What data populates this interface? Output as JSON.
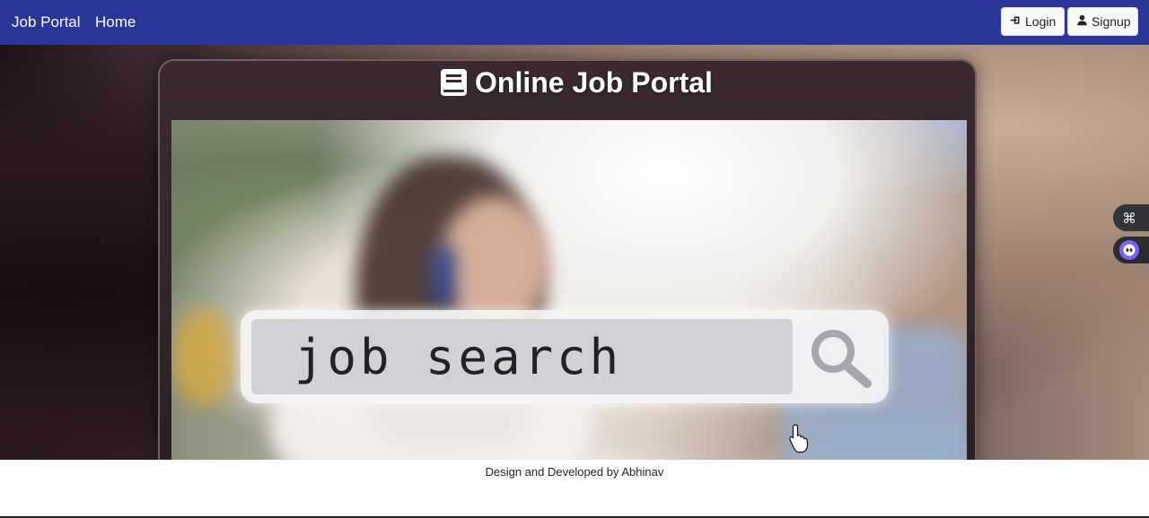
{
  "navbar": {
    "brand": "Job Portal",
    "home": "Home",
    "login_label": "Login",
    "signup_label": "Signup",
    "background_color": "#2b3698"
  },
  "hero": {
    "title": "Online Job Portal",
    "title_icon": "book-icon",
    "search_text": "job search",
    "search_icon": "magnifier-icon"
  },
  "widgets": {
    "first_icon": "command-icon",
    "second_icon": "assistant-face-icon"
  },
  "footer": {
    "text": "Design and Developed by Abhinav"
  }
}
